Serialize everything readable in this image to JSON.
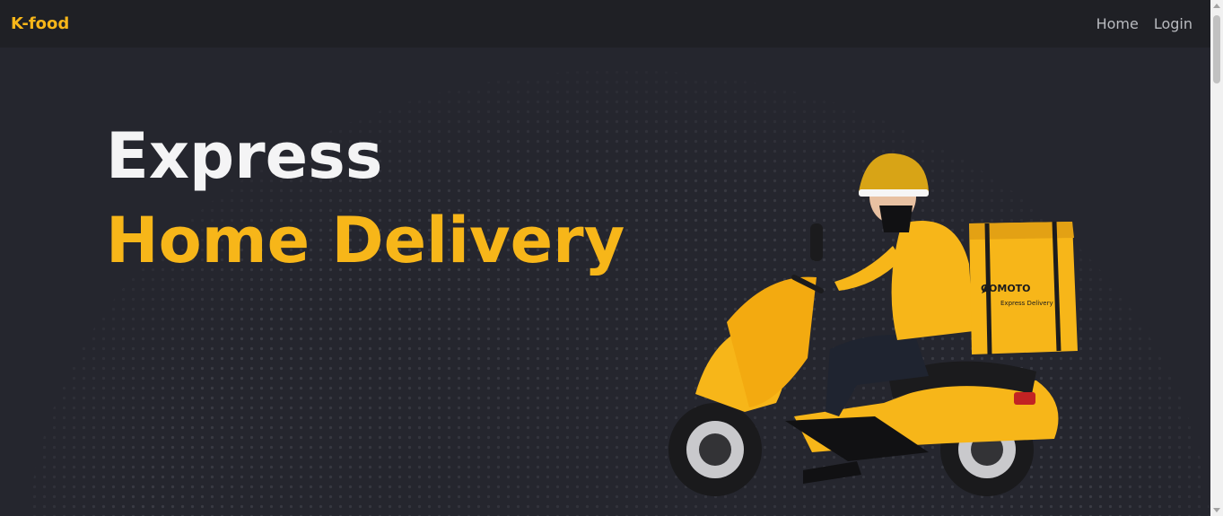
{
  "navbar": {
    "brand": "K-food",
    "links": [
      {
        "label": "Home"
      },
      {
        "label": "Login"
      }
    ]
  },
  "hero": {
    "line1": "Express",
    "line2": "Home Delivery",
    "box_brand": "GOMOTO",
    "box_tagline": "Express Delivery"
  },
  "colors": {
    "accent": "#f7b619",
    "background": "#25262e",
    "navbar": "#1f2025",
    "headline": "#f4f4f5"
  },
  "icons": [
    "rocket-icon"
  ]
}
